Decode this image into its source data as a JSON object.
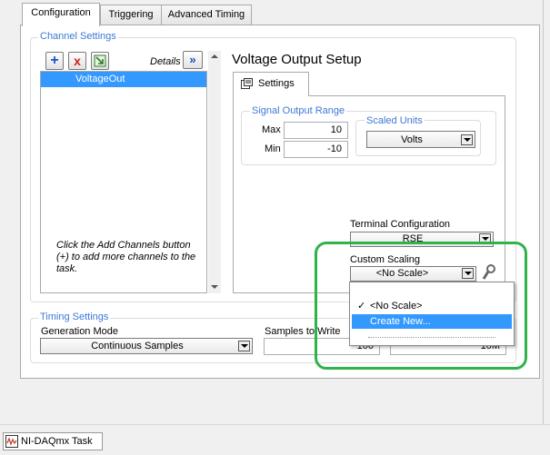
{
  "tabs": [
    {
      "label": "Configuration"
    },
    {
      "label": "Triggering"
    },
    {
      "label": "Advanced Timing"
    }
  ],
  "channel_settings": {
    "legend": "Channel Settings",
    "details_label": "Details",
    "add_icon": "+",
    "remove_icon": "x",
    "channels": [
      "VoltageOut"
    ],
    "hint": "Click the Add Channels button (+) to add more channels to the task."
  },
  "voltage_setup": {
    "title": "Voltage Output Setup",
    "settings_tab": "Settings",
    "range": {
      "legend": "Signal Output Range",
      "max_label": "Max",
      "max_value": "10",
      "min_label": "Min",
      "min_value": "-10"
    },
    "scaled_units": {
      "legend": "Scaled Units",
      "value": "Volts"
    },
    "terminal": {
      "label": "Terminal Configuration",
      "value": "RSE"
    },
    "custom_scaling": {
      "label": "Custom Scaling",
      "value": "<No Scale>",
      "options": [
        {
          "check": "✓",
          "label": "<No Scale>"
        },
        {
          "label": "Create New..."
        }
      ]
    }
  },
  "timing": {
    "legend": "Timing Settings",
    "generation_mode_label": "Generation Mode",
    "generation_mode_value": "Continuous Samples",
    "samples_label": "Samples to Write",
    "samples_value": "100",
    "rate_value": "10M"
  },
  "taskbar": {
    "label": "NI-DAQmx Task"
  },
  "colors": {
    "highlight": "#3399ff",
    "legend": "#3c78d8",
    "annotation": "#2db34a"
  }
}
